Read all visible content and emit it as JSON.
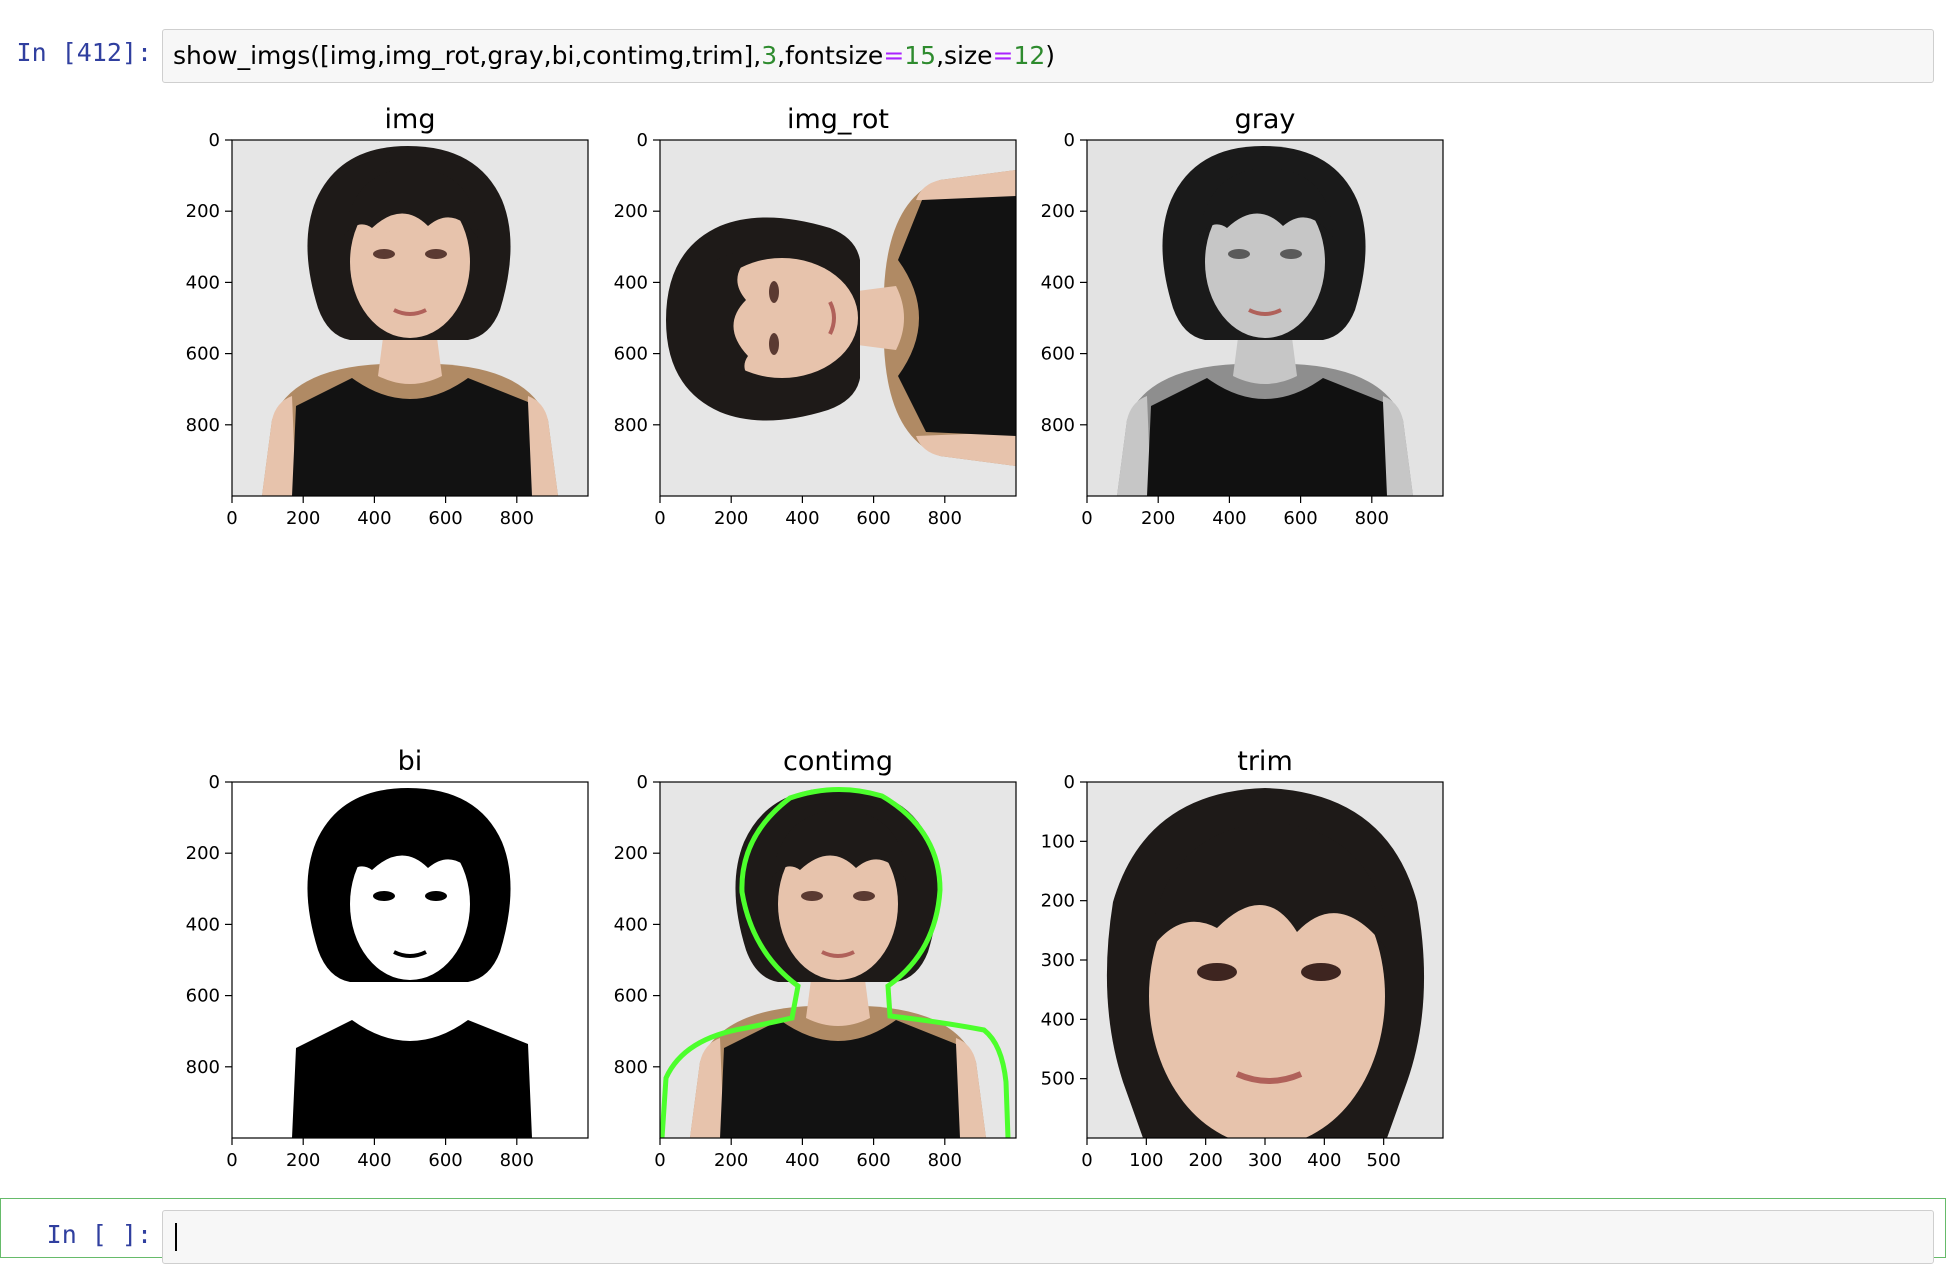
{
  "cell1": {
    "prompt": "In [412]:",
    "code": {
      "p1": "show_imgs([img,img_rot,gray,bi,contimg,trim],",
      "n1": "3",
      "p2": ",fontsize",
      "o1": "=",
      "n2": "15",
      "p3": ",size",
      "o2": "=",
      "n3": "12",
      "p4": ")"
    }
  },
  "cell2": {
    "prompt": "In [ ]:"
  },
  "figure": {
    "panels": [
      {
        "title": "img",
        "style": "color",
        "xticks": [
          "0",
          "200",
          "400",
          "600",
          "800"
        ],
        "yticks": [
          "0",
          "200",
          "400",
          "600",
          "800"
        ]
      },
      {
        "title": "img_rot",
        "style": "rot",
        "xticks": [
          "0",
          "200",
          "400",
          "600",
          "800"
        ],
        "yticks": [
          "0",
          "200",
          "400",
          "600",
          "800"
        ]
      },
      {
        "title": "gray",
        "style": "gray",
        "xticks": [
          "0",
          "200",
          "400",
          "600",
          "800"
        ],
        "yticks": [
          "0",
          "200",
          "400",
          "600",
          "800"
        ]
      },
      {
        "title": "bi",
        "style": "bi",
        "xticks": [
          "0",
          "200",
          "400",
          "600",
          "800"
        ],
        "yticks": [
          "0",
          "200",
          "400",
          "600",
          "800"
        ]
      },
      {
        "title": "contimg",
        "style": "cont",
        "xticks": [
          "0",
          "200",
          "400",
          "600",
          "800"
        ],
        "yticks": [
          "0",
          "200",
          "400",
          "600",
          "800"
        ]
      },
      {
        "title": "trim",
        "style": "trim",
        "xticks": [
          "0",
          "100",
          "200",
          "300",
          "400",
          "500"
        ],
        "yticks": [
          "0",
          "100",
          "200",
          "300",
          "400",
          "500"
        ]
      }
    ]
  },
  "colors": {
    "background": "#e6e6e6",
    "hair": "#1e1a18",
    "skin": "#e7c3ac",
    "tan": "#b08a64",
    "dress": "#121212",
    "contour": "#4cff2c",
    "prompt": "#303F9F"
  }
}
